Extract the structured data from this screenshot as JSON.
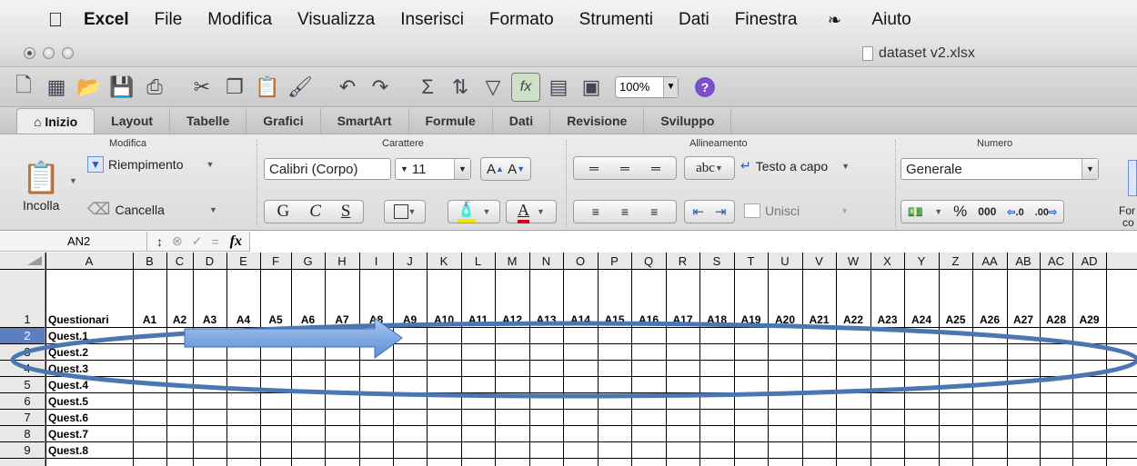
{
  "menubar": {
    "app": "Excel",
    "items": [
      "File",
      "Modifica",
      "Visualizza",
      "Inserisci",
      "Formato",
      "Strumenti",
      "Dati",
      "Finestra"
    ],
    "help": "Aiuto"
  },
  "window": {
    "filename": "dataset v2.xlsx"
  },
  "toolbar": {
    "zoom": "100%",
    "help_glyph": "?"
  },
  "tabs": [
    {
      "label": "Inizio"
    },
    {
      "label": "Layout"
    },
    {
      "label": "Tabelle"
    },
    {
      "label": "Grafici"
    },
    {
      "label": "SmartArt"
    },
    {
      "label": "Formule"
    },
    {
      "label": "Dati"
    },
    {
      "label": "Revisione"
    },
    {
      "label": "Sviluppo"
    }
  ],
  "ribbon": {
    "modifica": {
      "title": "Modifica",
      "paste": "Incolla",
      "fill": "Riempimento",
      "clear": "Cancella"
    },
    "carattere": {
      "title": "Carattere",
      "font": "Calibri (Corpo)",
      "size": "11",
      "bold": "G",
      "italic": "C",
      "underline": "S",
      "grow": "A",
      "shrink": "A",
      "color": "A"
    },
    "allineamento": {
      "title": "Allineamento",
      "abc": "abc",
      "wrap": "Testo a capo",
      "merge": "Unisci"
    },
    "numero": {
      "title": "Numero",
      "format": "Generale",
      "percent": "%",
      "thousands": "000",
      "inc": ".0",
      "dec": ".00",
      "more1": "For",
      "more2": "co"
    }
  },
  "formula_bar": {
    "cell": "AN2",
    "fx": "fx"
  },
  "sheet": {
    "columns": [
      "A",
      "B",
      "C",
      "D",
      "E",
      "F",
      "G",
      "H",
      "I",
      "J",
      "K",
      "L",
      "M",
      "N",
      "O",
      "P",
      "Q",
      "R",
      "S",
      "T",
      "U",
      "V",
      "W",
      "X",
      "Y",
      "Z",
      "AA",
      "AB",
      "AC",
      "AD"
    ],
    "row_numbers": [
      "1",
      "2",
      "3",
      "4",
      "5",
      "6",
      "7",
      "8",
      "9"
    ],
    "header_row": [
      "Questionari",
      "A1",
      "A2",
      "A3",
      "A4",
      "A5",
      "A6",
      "A7",
      "A8",
      "A9",
      "A10",
      "A11",
      "A12",
      "A13",
      "A14",
      "A15",
      "A16",
      "A17",
      "A18",
      "A19",
      "A20",
      "A21",
      "A22",
      "A23",
      "A24",
      "A25",
      "A26",
      "A27",
      "A28",
      "A29"
    ],
    "row_labels": [
      "Quest.1",
      "Quest.2",
      "Quest.3",
      "Quest.4",
      "Quest.5",
      "Quest.6",
      "Quest.7",
      "Quest.8"
    ],
    "active_row": "2"
  },
  "colors": {
    "ellipse": "#4a76b2",
    "arrow": "#5b8fd6",
    "active_row_header": "#5b7fbf"
  }
}
